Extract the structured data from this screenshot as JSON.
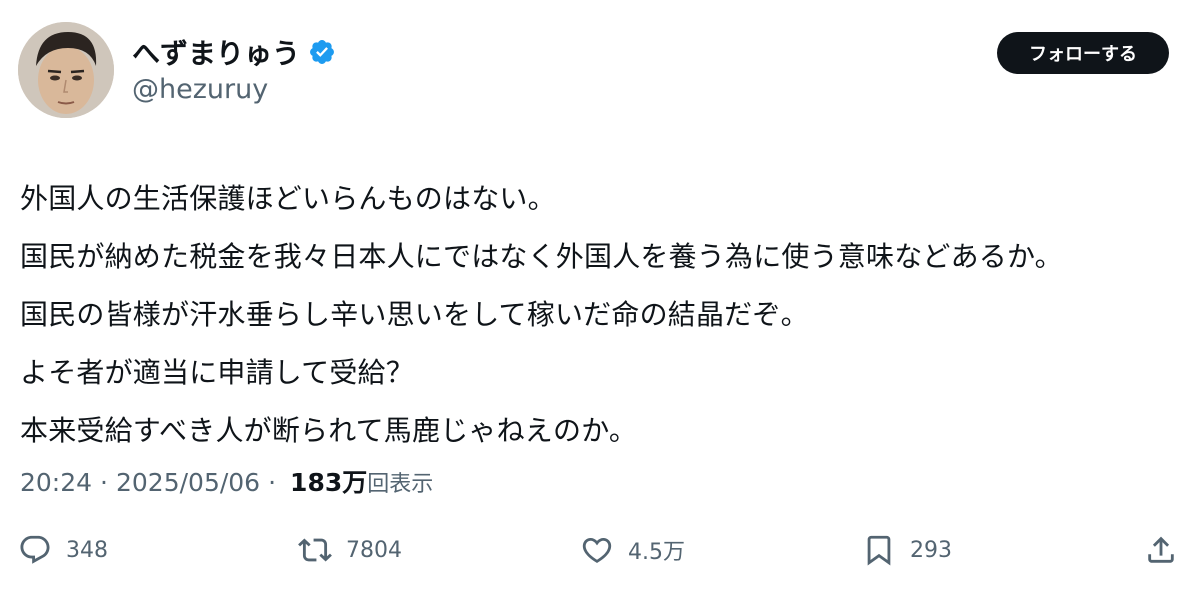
{
  "author": {
    "display_name": "へずまりゅう",
    "handle": "@hezuruy",
    "verified": true
  },
  "follow_button_label": "フォローする",
  "tweet": {
    "lines": [
      "外国人の生活保護ほどいらんものはない。",
      "国民が納めた税金を我々日本人にではなく外国人を養う為に使う意味などあるか。",
      "国民の皆様が汗水垂らし辛い思いをして稼いだ命の結晶だぞ。",
      "よそ者が適当に申請して受給？",
      "本来受給すべき人が断られて馬鹿じゃねえのか。"
    ]
  },
  "meta": {
    "time": "20:24",
    "separator": "·",
    "date": "2025/05/06",
    "views_count": "183万",
    "views_label": "回表示"
  },
  "actions": {
    "replies": "348",
    "retweets": "7804",
    "likes": "4.5万",
    "bookmarks": "293"
  },
  "colors": {
    "verified_badge": "#1d9bf0",
    "follow_button_bg": "#0f1419",
    "secondary_text": "#536471"
  },
  "icons": {
    "reply": "reply-icon",
    "retweet": "retweet-icon",
    "like": "heart-icon",
    "bookmark": "bookmark-icon",
    "share": "share-icon",
    "verified": "verified-badge-icon"
  }
}
